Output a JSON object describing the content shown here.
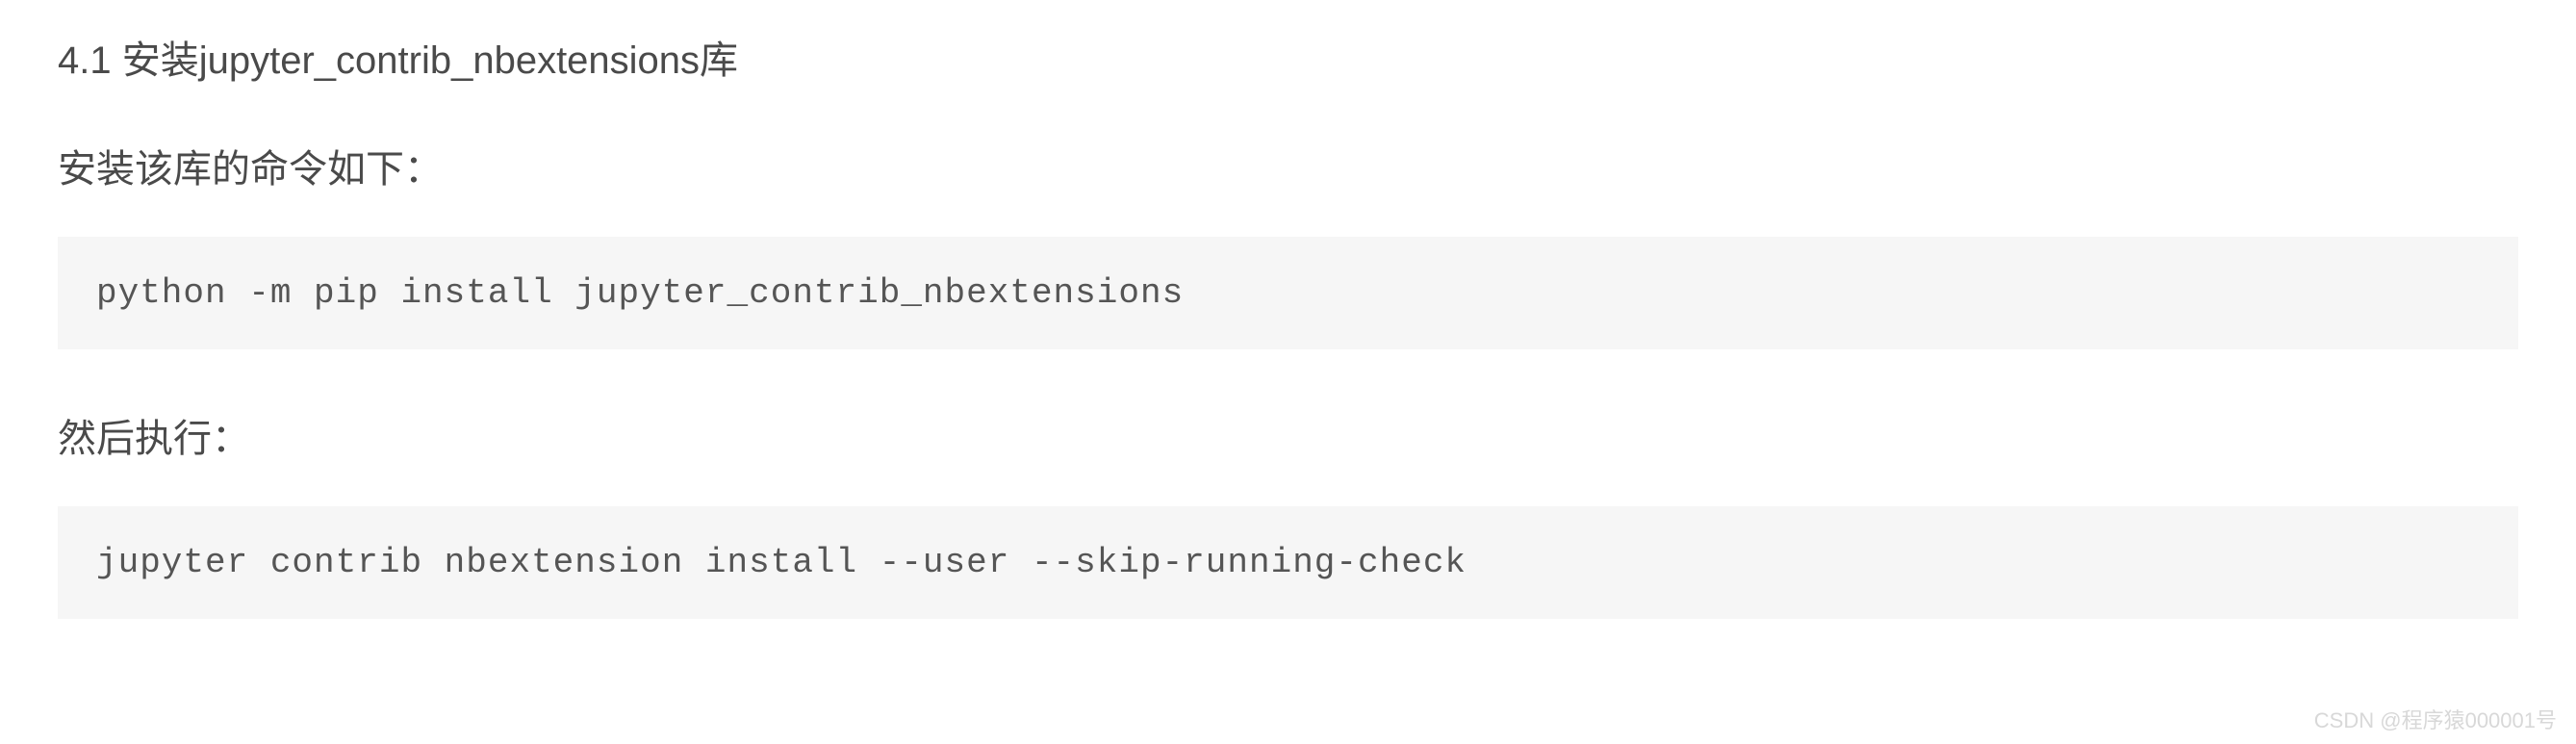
{
  "section": {
    "heading": "4.1 安装jupyter_contrib_nbextensions库",
    "para1": "安装该库的命令如下：",
    "code1": "python -m pip install jupyter_contrib_nbextensions",
    "para2": "然后执行：",
    "code2": "jupyter contrib nbextension install --user --skip-running-check"
  },
  "watermark": "CSDN @程序猿000001号"
}
